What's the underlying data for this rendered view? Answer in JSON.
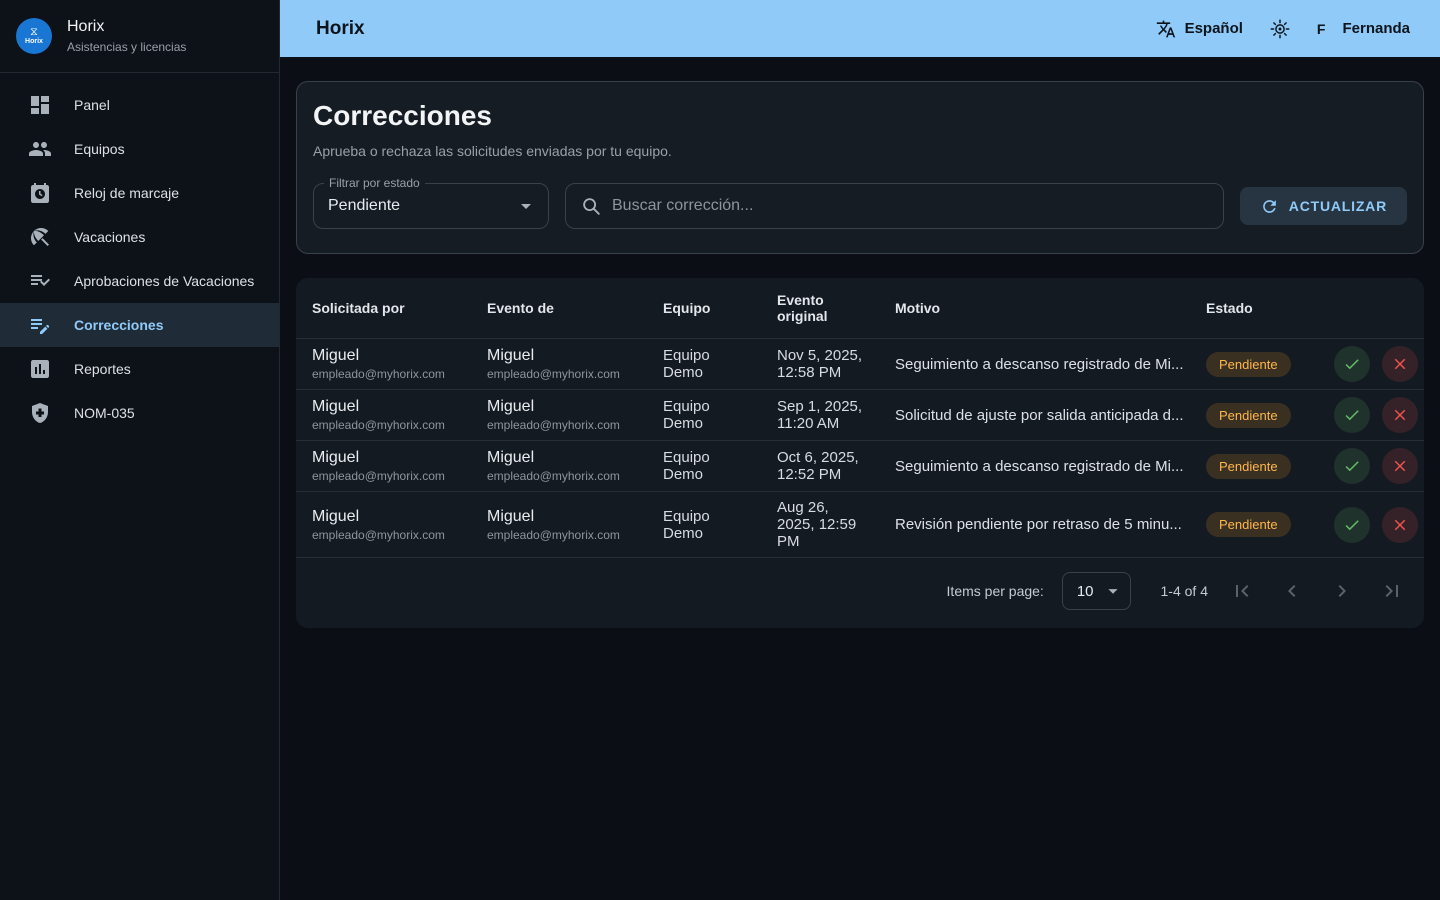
{
  "colors": {
    "accent": "#90caf9",
    "success": "#66bb6a",
    "error": "#ef5350",
    "warning": "#ffb74d"
  },
  "app": {
    "name": "Horix",
    "subtitle": "Asistencias y licencias",
    "logo_label": "Horix"
  },
  "header": {
    "title": "Horix",
    "language": "Español",
    "user_initial": "F",
    "user_name": "Fernanda"
  },
  "sidebar": {
    "items": [
      {
        "id": "panel",
        "label": "Panel",
        "icon": "dashboard-icon",
        "active": false
      },
      {
        "id": "equipos",
        "label": "Equipos",
        "icon": "groups-icon",
        "active": false
      },
      {
        "id": "reloj-de-marcaje",
        "label": "Reloj de marcaje",
        "icon": "punch-clock-icon",
        "active": false
      },
      {
        "id": "vacaciones",
        "label": "Vacaciones",
        "icon": "beach-icon",
        "active": false
      },
      {
        "id": "aprobaciones-de-vacaciones",
        "label": "Aprobaciones de Vacaciones",
        "icon": "checklist-check-icon",
        "active": false
      },
      {
        "id": "correcciones",
        "label": "Correcciones",
        "icon": "edit-note-icon",
        "active": true
      },
      {
        "id": "reportes",
        "label": "Reportes",
        "icon": "report-icon",
        "active": false
      },
      {
        "id": "nom-035",
        "label": "NOM-035",
        "icon": "health-safety-icon",
        "active": false
      }
    ]
  },
  "main": {
    "title": "Correcciones",
    "subtitle": "Aprueba o rechaza las solicitudes enviadas por tu equipo.",
    "filter": {
      "label": "Filtrar por estado",
      "value": "Pendiente"
    },
    "search": {
      "placeholder": "Buscar corrección..."
    },
    "refresh_label": "ACTUALIZAR",
    "table": {
      "columns": [
        "Solicitada por",
        "Evento de",
        "Equipo",
        "Evento original",
        "Motivo",
        "Estado"
      ],
      "rows": [
        {
          "solicitada_nombre": "Miguel",
          "solicitada_email": "empleado@myhorix.com",
          "evento_nombre": "Miguel",
          "evento_email": "empleado@myhorix.com",
          "equipo": "Equipo Demo",
          "fecha": "Nov 5, 2025, 12:58 PM",
          "motivo": "Seguimiento a descanso registrado de Mi...",
          "estado": "Pendiente"
        },
        {
          "solicitada_nombre": "Miguel",
          "solicitada_email": "empleado@myhorix.com",
          "evento_nombre": "Miguel",
          "evento_email": "empleado@myhorix.com",
          "equipo": "Equipo Demo",
          "fecha": "Sep 1, 2025, 11:20 AM",
          "motivo": "Solicitud de ajuste por salida anticipada d...",
          "estado": "Pendiente"
        },
        {
          "solicitada_nombre": "Miguel",
          "solicitada_email": "empleado@myhorix.com",
          "evento_nombre": "Miguel",
          "evento_email": "empleado@myhorix.com",
          "equipo": "Equipo Demo",
          "fecha": "Oct 6, 2025, 12:52 PM",
          "motivo": "Seguimiento a descanso registrado de Mi...",
          "estado": "Pendiente"
        },
        {
          "solicitada_nombre": "Miguel",
          "solicitada_email": "empleado@myhorix.com",
          "evento_nombre": "Miguel",
          "evento_email": "empleado@myhorix.com",
          "equipo": "Equipo Demo",
          "fecha": "Aug 26, 2025, 12:59 PM",
          "motivo": "Revisión pendiente por retraso de 5 minu...",
          "estado": "Pendiente"
        }
      ]
    },
    "pagination": {
      "label": "Items per page:",
      "page_size": "10",
      "range": "1-4 of 4"
    }
  }
}
